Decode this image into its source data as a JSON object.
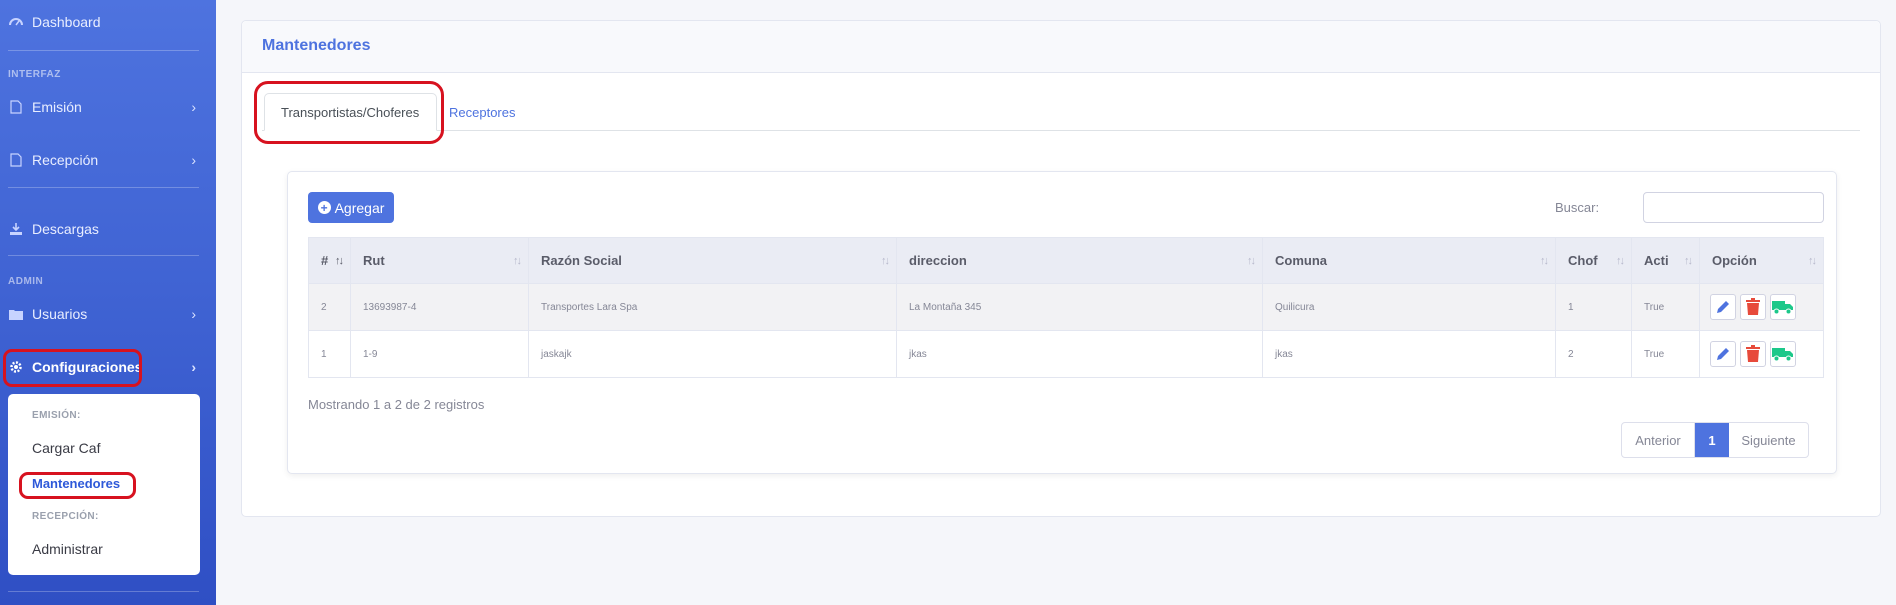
{
  "sidebar": {
    "dashboard": "Dashboard",
    "heading_interfaz": "INTERFAZ",
    "emision": "Emisión",
    "recepcion": "Recepción",
    "descargas": "Descargas",
    "heading_admin": "ADMIN",
    "usuarios": "Usuarios",
    "configuraciones": "Configuraciones",
    "submenu": {
      "heading_emision": "EMISIÓN:",
      "cargar_caf": "Cargar Caf",
      "mantenedores": "Mantenedores",
      "heading_recepcion": "RECEPCIÓN:",
      "administrar": "Administrar"
    }
  },
  "page": {
    "title": "Mantenedores",
    "tabs": [
      {
        "label": "Transportistas/Choferes",
        "active": true
      },
      {
        "label": "Receptores",
        "active": false
      }
    ]
  },
  "toolbar": {
    "add_label": "Agregar",
    "search_label": "Buscar:",
    "search_value": ""
  },
  "table": {
    "columns": [
      "#",
      "Rut",
      "Razón Social",
      "direccion",
      "Comuna",
      "Chof",
      "Acti",
      "Opción"
    ],
    "rows": [
      {
        "num": "2",
        "rut": "13693987-4",
        "razon": "Transportes Lara Spa",
        "direccion": "La Montaña 345",
        "comuna": "Quilicura",
        "chof": "1",
        "acti": "True"
      },
      {
        "num": "1",
        "rut": "1-9",
        "razon": "jaskajk",
        "direccion": "jkas",
        "comuna": "jkas",
        "chof": "2",
        "acti": "True"
      }
    ]
  },
  "footer": {
    "showing": "Mostrando 1 a 2 de 2 registros",
    "prev": "Anterior",
    "page": "1",
    "next": "Siguiente"
  },
  "colors": {
    "primary": "#4e73df",
    "danger": "#e74a3b",
    "success": "#1cc88a",
    "highlight": "#d7121f"
  }
}
